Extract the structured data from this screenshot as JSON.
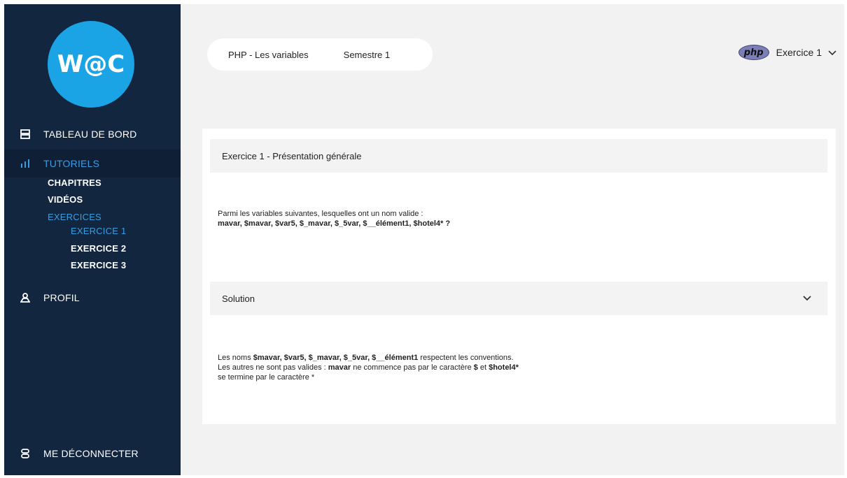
{
  "sidebar": {
    "logo_text": "W@C",
    "nav": {
      "dashboard": "TABLEAU DE BORD",
      "tutorials": "TUTORIELS",
      "profile": "PROFIL",
      "logout": "ME DÉCONNECTER"
    },
    "tutorials_sub": {
      "chapters": "CHAPITRES",
      "videos": "VIDÉOS",
      "exercises": "EXERCICES"
    },
    "exercises_sub": [
      "EXERCICE 1",
      "EXERCICE 2",
      "EXERCICE 3"
    ]
  },
  "header": {
    "breadcrumb_course": "PHP - Les variables",
    "breadcrumb_semester": "Semestre 1",
    "php_badge": "php",
    "exercise_selector": "Exercice 1"
  },
  "exercise": {
    "title": "Exercice 1 - Présentation générale",
    "question_line1": "Parmi les variables suivantes, lesquelles ont un nom valide :",
    "question_line2": "mavar, $mavar, $var5, $_mavar, $_5var, $__élément1, $hotel4* ?"
  },
  "solution": {
    "title": "Solution",
    "line1_prefix": "Les noms ",
    "line1_bold": "$mavar,  $var5,  $_mavar,  $_5var, $__élément1",
    "line1_suffix": " respectent les conventions.",
    "line2_prefix": "Les autres ne sont pas valides : ",
    "line2_bold1": "mavar",
    "line2_mid": " ne commence pas par le caractère ",
    "line2_bold2": "$",
    "line2_and": " et ",
    "line2_bold3": "$hotel4*",
    "line3": "se termine par le caractère *"
  },
  "colors": {
    "sidebar_bg": "#13263f",
    "accent": "#3b9ce0",
    "logo_bg": "#1aa4e6"
  }
}
